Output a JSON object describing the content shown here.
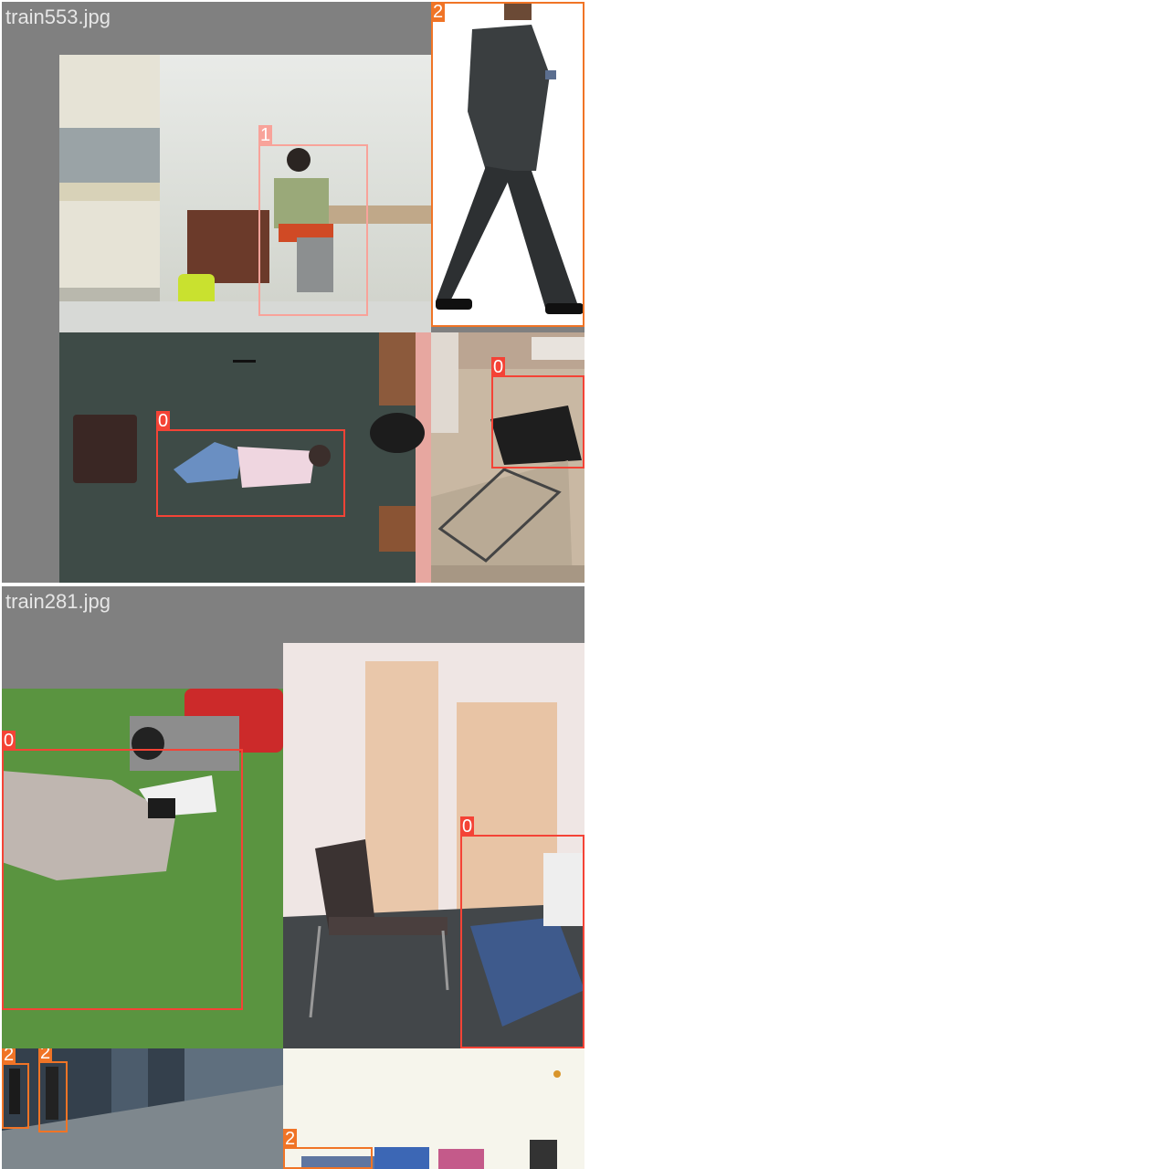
{
  "mosaics": [
    {
      "title": "train553.jpg",
      "labels": [
        "1",
        "2",
        "0",
        "0"
      ]
    },
    {
      "title": "train281.jpg",
      "labels": [
        "0",
        "0",
        "2",
        "2",
        "2"
      ]
    }
  ],
  "class_colors": {
    "0": "#f44336",
    "1": "#f8a39a",
    "2": "#f07426"
  }
}
